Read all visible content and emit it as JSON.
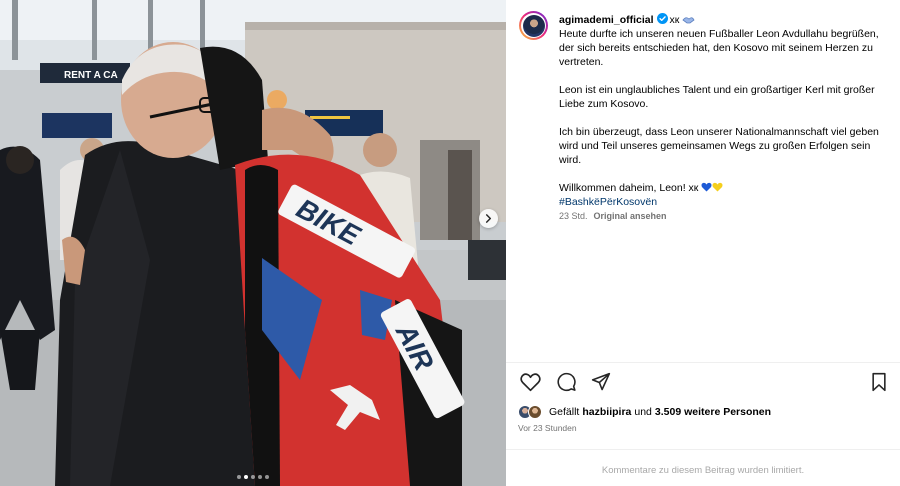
{
  "post": {
    "carousel": {
      "slide_count": 5,
      "active_index": 1
    }
  },
  "caption": {
    "username": "agimademi_official",
    "username_suffix": "xк",
    "line1": "Heute durfte ich unseren neuen Fußballer Leon Avdullahu begrüßen, der sich bereits entschieden hat, den Kosovo mit seinem Herzen zu vertreten.",
    "para2": "Leon ist ein unglaubliches Talent und ein großartiger Kerl mit großer Liebe zum Kosovo.",
    "para3": "Ich bin überzeugt, dass Leon unserer Nationalmannschaft viel geben wird und Teil unseres gemeinsamen Wegs zu großen Erfolgen sein wird.",
    "para4": "Willkommen daheim, Leon! xк",
    "hashtag": "#BashkëPërKosovën",
    "age": "23 Std.",
    "see_original": "Original ansehen"
  },
  "likes": {
    "prefix": "Gefällt",
    "user": "hazbiipira",
    "middle": "und",
    "count": "3.509 weitere Personen"
  },
  "timestamp": "Vor 23 Stunden",
  "comments_notice": "Kommentare zu diesem Beitrag wurden limitiert.",
  "photo_signs": {
    "rent": "RENT A CA",
    "jersey_top": "BIKE",
    "jersey_bottom": "AIR"
  },
  "colors": {
    "link": "#00376b",
    "muted": "#737373",
    "verified": "#0095f6",
    "heart_blue": "#1e5bd6",
    "heart_yellow": "#f5cf1d"
  },
  "icons": [
    "heart-icon",
    "comment-icon",
    "share-icon",
    "bookmark-icon",
    "verified-icon",
    "chevron-right-icon"
  ]
}
